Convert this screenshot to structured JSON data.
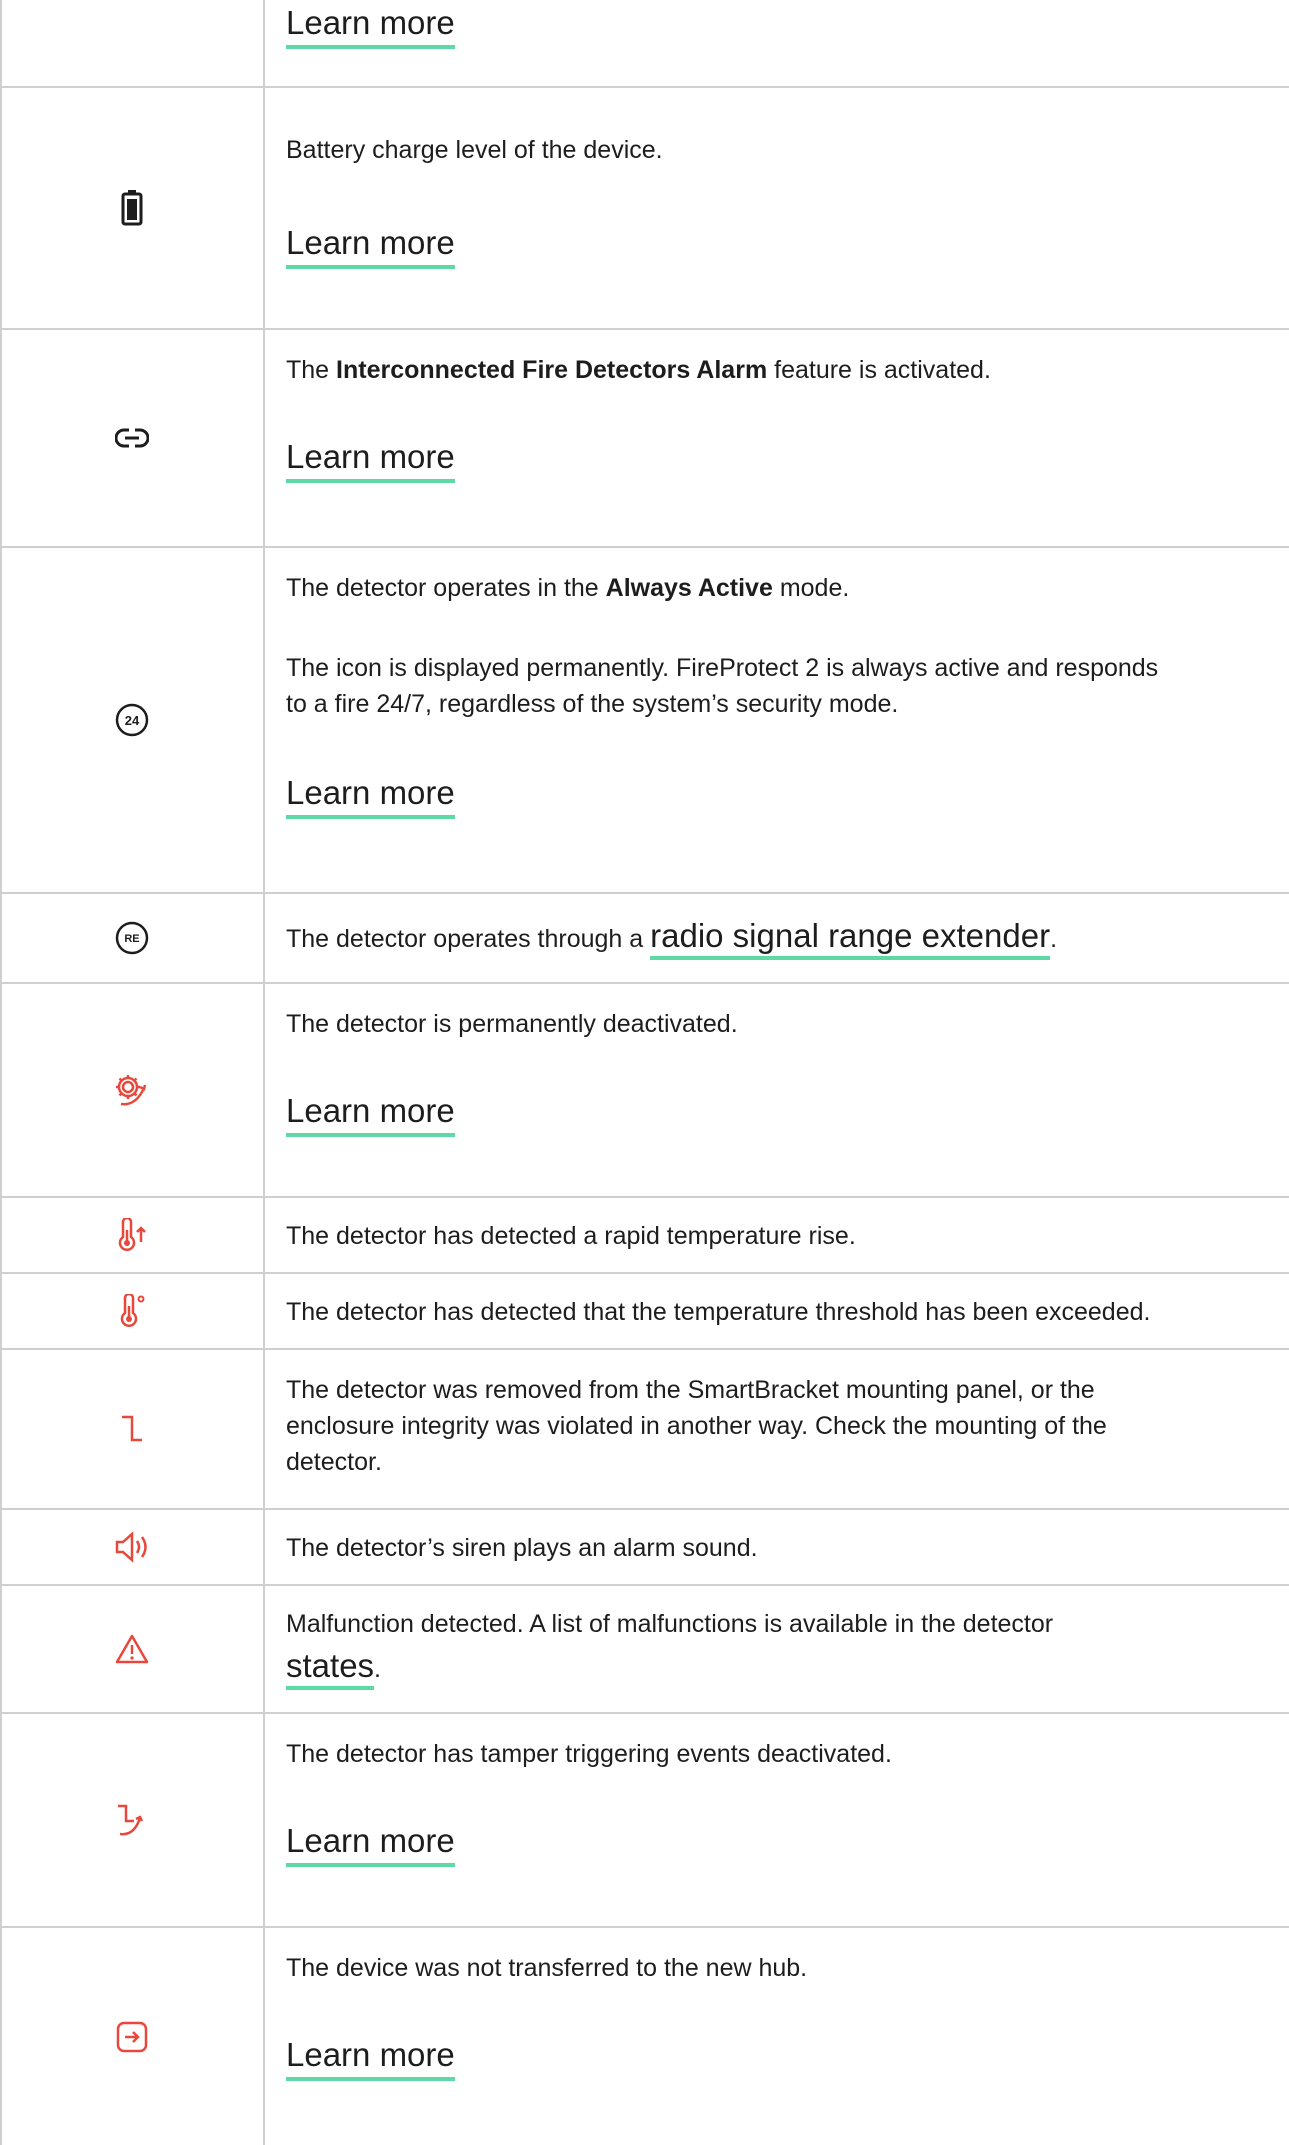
{
  "learn_more": "Learn more",
  "rows": {
    "top": {
      "link": "Learn more"
    },
    "battery": {
      "text": "Battery charge level of the device.",
      "link": "Learn more"
    },
    "interconnected": {
      "pre": "The ",
      "bold": "Interconnected Fire Detectors Alarm",
      "post": " feature is activated.",
      "link": "Learn more"
    },
    "always_active": {
      "pre": "The detector operates in the ",
      "bold": "Always Active",
      "post": " mode.",
      "line2a": "The icon is displayed permanently. FireProtect 2 is always active and responds",
      "line2b": "to a fire 24/7, regardless of the system’s security mode.",
      "link": "Learn more",
      "icon_text": "24"
    },
    "re": {
      "pre": "The detector operates through a ",
      "link": "radio signal range extender",
      "post": ".",
      "icon_text": "RE"
    },
    "deactivated": {
      "text": "The detector is permanently deactivated.",
      "link": "Learn more"
    },
    "rapid_temp": {
      "text": "The detector has detected a rapid temperature rise."
    },
    "threshold": {
      "text": "The detector has detected that the temperature threshold has been exceeded."
    },
    "tamper": {
      "line1": "The detector was removed from the SmartBracket mounting panel, or the",
      "line2": "enclosure integrity was violated in another way. Check the mounting of the",
      "line3": "detector."
    },
    "siren": {
      "text": "The detector’s siren plays an alarm sound."
    },
    "malfunction": {
      "line1": "Malfunction detected. A list of malfunctions is available in the detector",
      "link": "states",
      "post": "."
    },
    "tamper_off": {
      "text": "The detector has tamper triggering events deactivated.",
      "link": "Learn more"
    },
    "not_transferred": {
      "text": "The device was not transferred to the new hub.",
      "link": "Learn more"
    }
  },
  "colors": {
    "accent": "#5ed9a5",
    "alert": "#e8483b",
    "border": "#cfcfcf",
    "text": "#1d1d1d"
  }
}
